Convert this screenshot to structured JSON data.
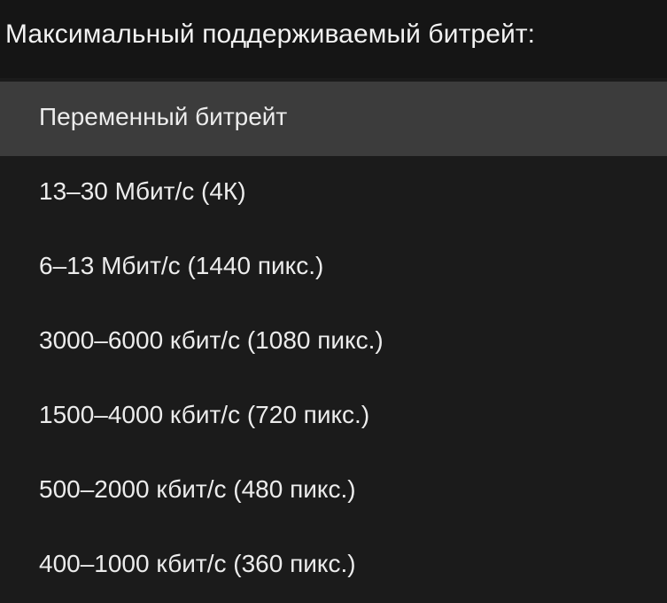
{
  "header": {
    "label": "Максимальный поддерживаемый битрейт:"
  },
  "options": [
    {
      "label": "Переменный битрейт",
      "selected": true
    },
    {
      "label": "13–30 Мбит/с (4К)",
      "selected": false
    },
    {
      "label": "6–13 Мбит/с (1440 пикс.)",
      "selected": false
    },
    {
      "label": "3000–6000 кбит/с (1080 пикс.)",
      "selected": false
    },
    {
      "label": "1500–4000 кбит/с (720 пикс.)",
      "selected": false
    },
    {
      "label": "500–2000 кбит/с (480 пикс.)",
      "selected": false
    },
    {
      "label": "400–1000 кбит/с (360 пикс.)",
      "selected": false
    }
  ],
  "colors": {
    "background": "#1b1b1b",
    "header_background": "#151515",
    "selected_background": "#3c3c3c",
    "text": "#ececec"
  }
}
